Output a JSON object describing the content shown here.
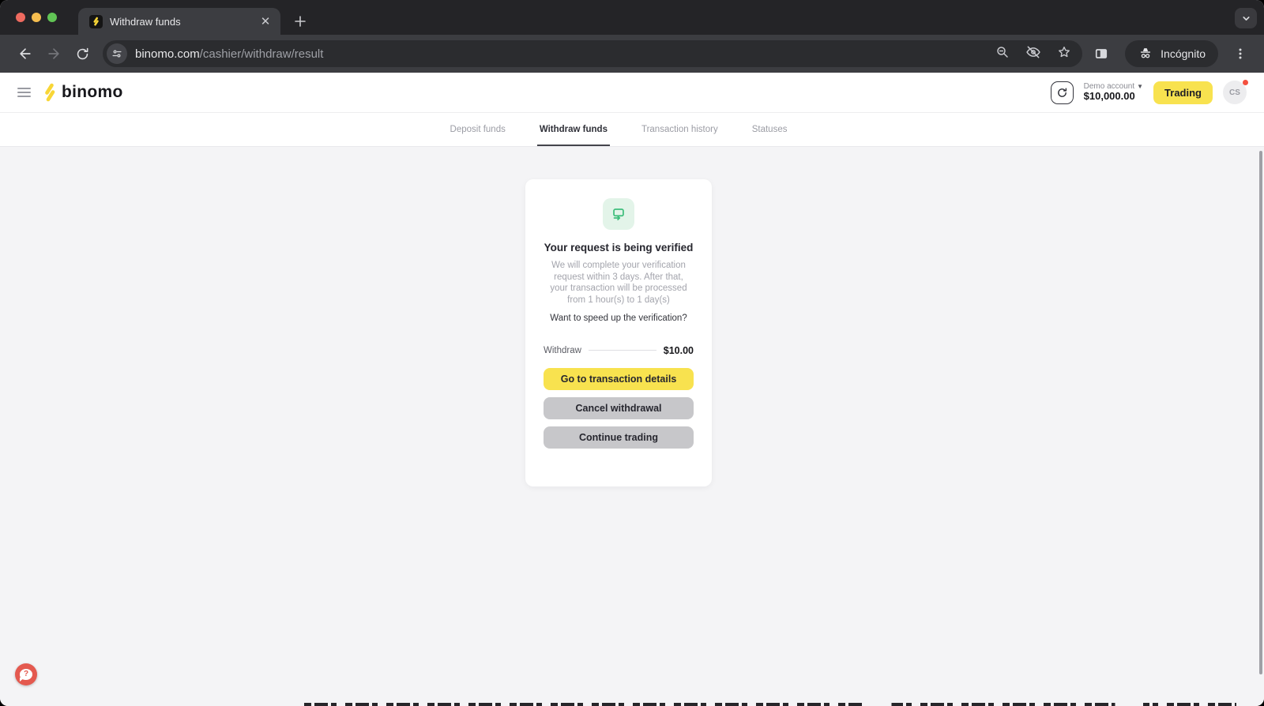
{
  "chrome": {
    "tab_title": "Withdraw funds",
    "url_domain": "binomo.com",
    "url_path": "/cashier/withdraw/result",
    "incognito_label": "Incógnito"
  },
  "header": {
    "brand": "binomo",
    "account_label": "Demo account",
    "balance": "$10,000.00",
    "trading_label": "Trading",
    "avatar_initials": "CS"
  },
  "nav": {
    "tabs": [
      {
        "label": "Deposit funds",
        "active": false
      },
      {
        "label": "Withdraw funds",
        "active": true
      },
      {
        "label": "Transaction history",
        "active": false
      },
      {
        "label": "Statuses",
        "active": false
      }
    ]
  },
  "card": {
    "title": "Your request is being verified",
    "description": "We will complete your verification request within 3 days. After that, your transaction will be processed from 1 hour(s) to 1 day(s)",
    "speed_up_question": "Want to speed up the verification?",
    "summary_label": "Withdraw",
    "summary_amount": "$10.00",
    "primary_button": "Go to transaction details",
    "secondary_button": "Cancel withdrawal",
    "tertiary_button": "Continue trading"
  },
  "colors": {
    "brand_yellow": "#F8E24F",
    "success_green": "#3FBE7C",
    "success_green_bg": "#E3F4E9",
    "help_coral": "#E4594F",
    "notification_red": "#F4503F"
  }
}
